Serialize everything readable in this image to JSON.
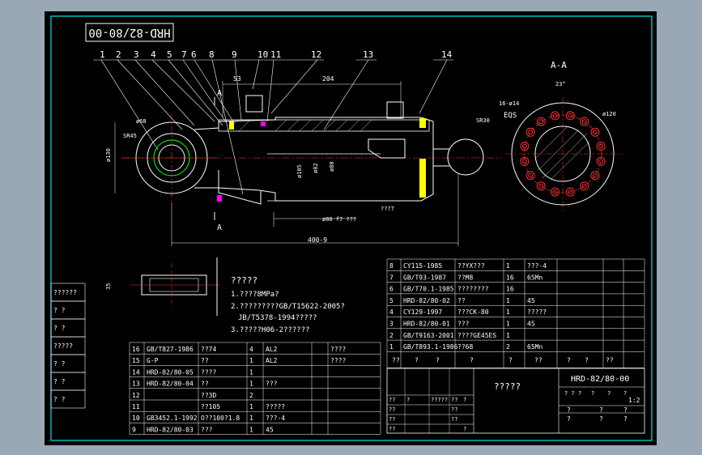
{
  "title_block_code": "HRD-82/80-00",
  "part_numbers": [
    "1",
    "2",
    "3",
    "4",
    "5",
    "7",
    "6",
    "8",
    "9",
    "10",
    "11",
    "12",
    "13",
    "14"
  ],
  "section_label": "A-A",
  "section_marks": [
    "A",
    "A"
  ],
  "dims": {
    "d53": "53",
    "d204": "204",
    "d400": "400-9",
    "d130": "ø130",
    "d68": "ø68",
    "sr45": "SR45",
    "sr30": "SR30",
    "d105": "ø105",
    "d82": "ø82",
    "d80": "ø80",
    "stroke_note": "???7",
    "shaft_note": "ø80 f7 ???",
    "d35": "35",
    "angle": "23°",
    "holes": "16-ø14",
    "eqs": "EQS",
    "d120": "ø120"
  },
  "notes": {
    "title": "?????",
    "line1": "1.????8MPa?",
    "line2": "2.?????????GB/T15622-2005?",
    "line3": "JB/T5378-1994?????",
    "line4": "3.?????H06-2??????"
  },
  "upper_bom": [
    [
      "8",
      "CY115-1985",
      "??YX???",
      "1",
      "???-4",
      ""
    ],
    [
      "7",
      "GB/T93-1987",
      "??M8",
      "16",
      "65Mn",
      ""
    ],
    [
      "6",
      "GB/T70.1-1985",
      "????????",
      "16",
      "",
      ""
    ],
    [
      "5",
      "HRD-82/80-02",
      "??",
      "1",
      "45",
      ""
    ],
    [
      "4",
      "CY129-1997",
      "???CK-80",
      "1",
      "?????",
      ""
    ],
    [
      "3",
      "HRD-82/80-01",
      "???",
      "1",
      "45",
      ""
    ],
    [
      "2",
      "GB/T9163-2001",
      "????GE45ES",
      "1",
      "",
      ""
    ],
    [
      "1",
      "GB/T893.1-1986",
      "??68",
      "2",
      "65Mn",
      ""
    ]
  ],
  "upper_header": [
    "??",
    "?",
    "?",
    "?",
    "?",
    "??",
    "?",
    "?",
    "??"
  ],
  "lower_bom": [
    [
      "16",
      "GB/T827-1986",
      "??74",
      "4",
      "AL2",
      "",
      "????"
    ],
    [
      "15",
      "G-P",
      "??",
      "1",
      "AL2",
      "",
      "????"
    ],
    [
      "14",
      "HRD-82/80-05",
      "????",
      "1",
      "",
      "",
      ""
    ],
    [
      "13",
      "HRD-82/80-04",
      "??",
      "1",
      "???",
      "",
      ""
    ],
    [
      "12",
      "",
      "??3D",
      "2",
      "",
      "",
      ""
    ],
    [
      "11",
      "",
      "??105",
      "1",
      "?????",
      "",
      ""
    ],
    [
      "10",
      "GB3452.1-1992",
      "O??100?1.8",
      "1",
      "???-4",
      "",
      ""
    ],
    [
      "9",
      "HRD-82/80-03",
      "???",
      "1",
      "45",
      "",
      ""
    ]
  ],
  "left_strip": [
    "??????",
    "?  ?",
    "?  ?",
    "?????",
    "?  ?",
    "?  ?",
    "?  ?"
  ],
  "title_block": {
    "name": "?????",
    "code": "HRD-82/80-00",
    "scale": "1:2",
    "sign_rows": [
      [
        "??",
        "?",
        "?????",
        "??",
        "?"
      ],
      [
        "??",
        "",
        "",
        "??",
        ""
      ],
      [
        "??",
        "",
        "",
        "??",
        ""
      ],
      [
        "??",
        "",
        "",
        "",
        "?"
      ]
    ],
    "stage_labels": [
      "? ? ?",
      "?",
      "?",
      "?"
    ],
    "sheet": [
      "?",
      "?",
      "?",
      "?",
      "?",
      "?"
    ]
  },
  "colors": {
    "background": "#9aa8b6",
    "sheet": "#000000",
    "border": "#00e5e5",
    "outline": "#ffffff",
    "title": "#ffff00",
    "red": "#ff2020",
    "yellow": "#ffff00",
    "magenta": "#ff00ff",
    "green": "#00ff00",
    "center": "#ff3030"
  }
}
